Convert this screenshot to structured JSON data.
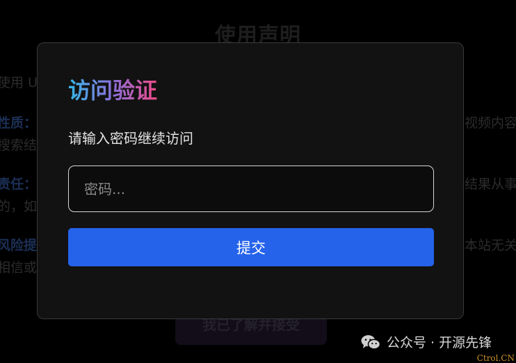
{
  "background_page": {
    "title": "使用声明",
    "fragments": [
      {
        "id": "l1",
        "text": "使用 U",
        "accent": false
      },
      {
        "id": "l2",
        "text": "性质：",
        "accent": true
      },
      {
        "id": "l3",
        "text": "搜索结",
        "accent": false
      },
      {
        "id": "l4",
        "text": "责任：",
        "accent": true
      },
      {
        "id": "l5",
        "text": "的，如",
        "accent": false
      },
      {
        "id": "l6",
        "text": "风险提",
        "accent": true
      },
      {
        "id": "l7",
        "text": "相信或",
        "accent": false
      },
      {
        "id": "r1",
        "text": "视频内容",
        "accent": false
      },
      {
        "id": "r2",
        "text": "结果从事",
        "accent": false
      },
      {
        "id": "r3",
        "text": "本站无关",
        "accent": false
      }
    ],
    "ack_button_label": "我已了解并接受"
  },
  "modal": {
    "title": "访问验证",
    "subtitle": "请输入密码继续访问",
    "password_placeholder": "密码...",
    "password_value": "",
    "submit_label": "提交",
    "accent_color": "#2563eb"
  },
  "watermark": {
    "icon": "wechat-icon",
    "text": "公众号 · 开源先锋",
    "corner": "Ctrol.CN"
  }
}
